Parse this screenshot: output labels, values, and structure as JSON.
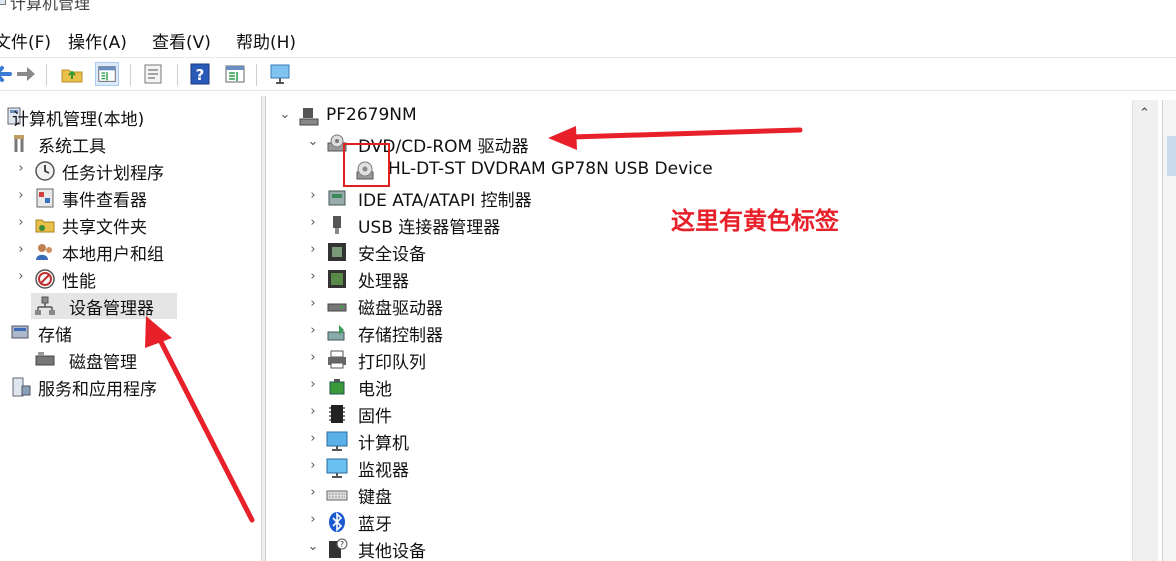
{
  "window": {
    "title": "计算机管理"
  },
  "menu": [
    "文件(F)",
    "操作(A)",
    "查看(V)",
    "帮助(H)"
  ],
  "toolbar": {
    "buttons": [
      "back-icon",
      "forward-icon",
      "up-folder-icon",
      "show-tree-icon",
      "properties-icon",
      "help-icon",
      "show-action-pane-icon",
      "monitor-icon"
    ],
    "active": "show-tree-icon"
  },
  "left_tree": [
    {
      "label": "计算机管理(本地)",
      "icon": "computer-management-icon",
      "expand": "",
      "level": 0
    },
    {
      "label": "系统工具",
      "icon": "system-tools-icon",
      "expand": "",
      "level": 1
    },
    {
      "label": "任务计划程序",
      "icon": "task-scheduler-icon",
      "expand": "›",
      "level": 2
    },
    {
      "label": "事件查看器",
      "icon": "event-viewer-icon",
      "expand": "›",
      "level": 2
    },
    {
      "label": "共享文件夹",
      "icon": "shared-folders-icon",
      "expand": "›",
      "level": 2
    },
    {
      "label": "本地用户和组",
      "icon": "local-users-icon",
      "expand": "›",
      "level": 2
    },
    {
      "label": "性能",
      "icon": "performance-icon",
      "expand": "›",
      "level": 2
    },
    {
      "label": "设备管理器",
      "icon": "device-manager-icon",
      "expand": "",
      "level": 2,
      "selected": true
    },
    {
      "label": "存储",
      "icon": "storage-icon",
      "expand": "",
      "level": 1
    },
    {
      "label": "磁盘管理",
      "icon": "disk-management-icon",
      "expand": "",
      "level": 2
    },
    {
      "label": "服务和应用程序",
      "icon": "services-apps-icon",
      "expand": "",
      "level": 1
    }
  ],
  "right_tree": [
    {
      "label": "PF2679NM",
      "icon": "computer-root-icon",
      "expand": "⌄",
      "level": 0
    },
    {
      "label": "DVD/CD-ROM 驱动器",
      "icon": "dvd-drive-icon",
      "expand": "⌄",
      "level": 1
    },
    {
      "label": "HL-DT-ST DVDRAM GP78N USB Device",
      "icon": "dvd-device-icon",
      "expand": "",
      "level": 2
    },
    {
      "label": "IDE ATA/ATAPI 控制器",
      "icon": "ide-controller-icon",
      "expand": "›",
      "level": 1
    },
    {
      "label": "USB 连接器管理器",
      "icon": "usb-connector-icon",
      "expand": "›",
      "level": 1
    },
    {
      "label": "安全设备",
      "icon": "security-device-icon",
      "expand": "›",
      "level": 1
    },
    {
      "label": "处理器",
      "icon": "processor-icon",
      "expand": "›",
      "level": 1
    },
    {
      "label": "磁盘驱动器",
      "icon": "disk-drive-icon",
      "expand": "›",
      "level": 1
    },
    {
      "label": "存储控制器",
      "icon": "storage-controller-icon",
      "expand": "›",
      "level": 1
    },
    {
      "label": "打印队列",
      "icon": "print-queue-icon",
      "expand": "›",
      "level": 1
    },
    {
      "label": "电池",
      "icon": "battery-icon",
      "expand": "›",
      "level": 1
    },
    {
      "label": "固件",
      "icon": "firmware-icon",
      "expand": "›",
      "level": 1
    },
    {
      "label": "计算机",
      "icon": "computer-icon",
      "expand": "›",
      "level": 1
    },
    {
      "label": "监视器",
      "icon": "monitor-device-icon",
      "expand": "›",
      "level": 1
    },
    {
      "label": "键盘",
      "icon": "keyboard-icon",
      "expand": "›",
      "level": 1
    },
    {
      "label": "蓝牙",
      "icon": "bluetooth-icon",
      "expand": "›",
      "level": 1
    },
    {
      "label": "其他设备",
      "icon": "other-devices-icon",
      "expand": "⌄",
      "level": 1
    }
  ],
  "annotation": {
    "text": "这里有黄色标签"
  },
  "colors": {
    "annotation": "#e8202a",
    "selection": "#e5e5e5",
    "accent": "#2f7fd8"
  }
}
